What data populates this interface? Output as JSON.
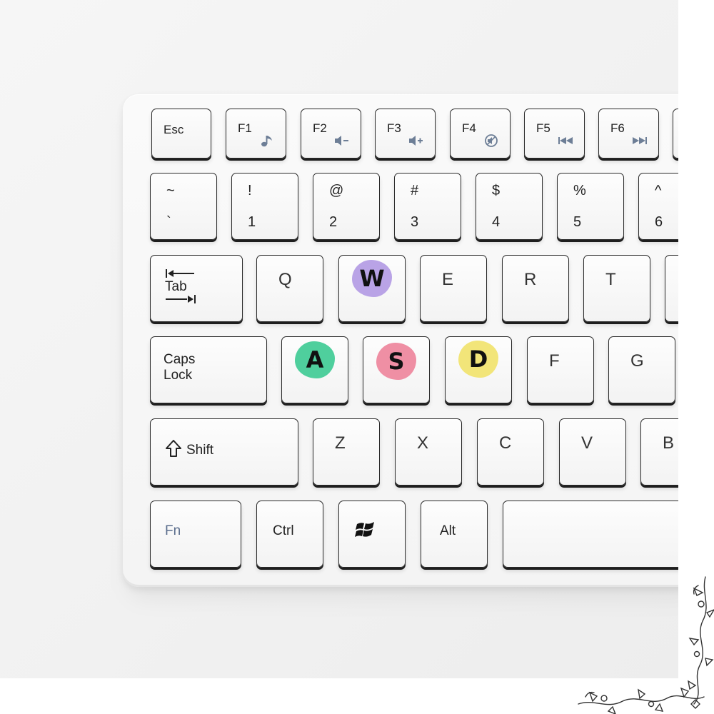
{
  "keys": {
    "esc": "Esc",
    "f1": "F1",
    "f2": "F2",
    "f3": "F3",
    "f4": "F4",
    "f5": "F5",
    "f6": "F6",
    "tilde_top": "~",
    "tilde_bot": "`",
    "k1_top": "!",
    "k1_bot": "1",
    "k2_top": "@",
    "k2_bot": "2",
    "k3_top": "#",
    "k3_bot": "3",
    "k4_top": "$",
    "k4_bot": "4",
    "k5_top": "%",
    "k5_bot": "5",
    "k6_top": "^",
    "k6_bot": "6",
    "tab": "Tab",
    "q": "Q",
    "w": "W",
    "e": "E",
    "r": "R",
    "t": "T",
    "caps_line1": "Caps",
    "caps_line2": "Lock",
    "a": "A",
    "s": "S",
    "d": "D",
    "f": "F",
    "g": "G",
    "shift": "Shift",
    "z": "Z",
    "x": "X",
    "c": "C",
    "v": "V",
    "b": "B",
    "fn": "Fn",
    "ctrl": "Ctrl",
    "alt": "Alt"
  },
  "icons": {
    "f1": "music-note-icon",
    "f2": "volume-down-icon",
    "f3": "volume-up-icon",
    "f4": "mute-icon",
    "f5": "previous-track-icon",
    "f6": "next-track-icon",
    "windows": "windows-logo-icon",
    "shift": "shift-arrow-icon",
    "tab": "tab-arrows-icon"
  },
  "colors": {
    "sticker_w": "#b9a3e6",
    "sticker_a": "#4fcf9d",
    "sticker_s": "#ef8fa4",
    "sticker_d": "#f2e579",
    "fn_icon": "#6d7e96",
    "fn_label": "#5a6d8c"
  }
}
